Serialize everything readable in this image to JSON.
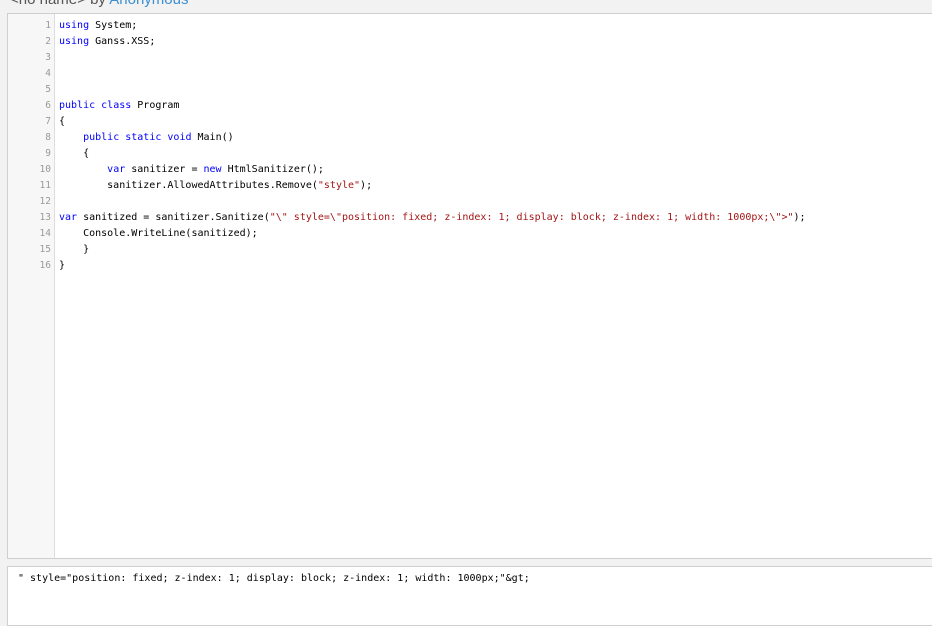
{
  "header": {
    "name": "<no name>",
    "by": "by",
    "author": "Anonymous"
  },
  "editor": {
    "lines": [
      {
        "n": "1",
        "parts": [
          {
            "t": "using",
            "c": "kw"
          },
          {
            "t": " System;"
          }
        ]
      },
      {
        "n": "2",
        "parts": [
          {
            "t": "using",
            "c": "kw"
          },
          {
            "t": " Ganss.XSS;"
          }
        ]
      },
      {
        "n": "3",
        "parts": []
      },
      {
        "n": "4",
        "parts": []
      },
      {
        "n": "5",
        "parts": []
      },
      {
        "n": "6",
        "parts": [
          {
            "t": "public",
            "c": "kw"
          },
          {
            "t": " "
          },
          {
            "t": "class",
            "c": "kw"
          },
          {
            "t": " Program"
          }
        ]
      },
      {
        "n": "7",
        "parts": [
          {
            "t": "{"
          }
        ]
      },
      {
        "n": "8",
        "parts": [
          {
            "t": "    "
          },
          {
            "t": "public",
            "c": "kw"
          },
          {
            "t": " "
          },
          {
            "t": "static",
            "c": "kw"
          },
          {
            "t": " "
          },
          {
            "t": "void",
            "c": "kw"
          },
          {
            "t": " Main()"
          }
        ]
      },
      {
        "n": "9",
        "parts": [
          {
            "t": "    {"
          }
        ]
      },
      {
        "n": "10",
        "parts": [
          {
            "t": "        "
          },
          {
            "t": "var",
            "c": "kw"
          },
          {
            "t": " sanitizer = "
          },
          {
            "t": "new",
            "c": "kw"
          },
          {
            "t": " HtmlSanitizer();"
          }
        ]
      },
      {
        "n": "11",
        "parts": [
          {
            "t": "        sanitizer.AllowedAttributes.Remove("
          },
          {
            "t": "\"style\"",
            "c": "st"
          },
          {
            "t": ");"
          }
        ]
      },
      {
        "n": "12",
        "parts": []
      },
      {
        "n": "13",
        "parts": [
          {
            "t": "var",
            "c": "kw"
          },
          {
            "t": " sanitized = sanitizer.Sanitize("
          },
          {
            "t": "\"\\\" style=\\\"position: fixed; z-index: 1; display: block; z-index: 1; width: 1000px;\\\">\"",
            "c": "st"
          },
          {
            "t": ");"
          }
        ]
      },
      {
        "n": "14",
        "parts": [
          {
            "t": "    Console.WriteLine(sanitized);"
          }
        ]
      },
      {
        "n": "15",
        "parts": [
          {
            "t": "    }"
          }
        ]
      },
      {
        "n": "16",
        "parts": [
          {
            "t": "}"
          }
        ]
      }
    ]
  },
  "output": {
    "text": "\" style=\"position: fixed; z-index: 1; display: block; z-index: 1; width: 1000px;\"&gt;"
  }
}
